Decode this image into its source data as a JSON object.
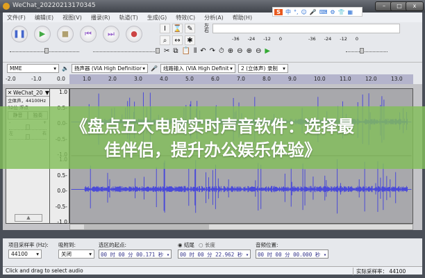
{
  "window": {
    "title": "WeChat_20220213170345"
  },
  "ime": {
    "logo": "S",
    "items": [
      "中",
      "°,",
      "☺",
      "🎤",
      "⌨",
      "⚙",
      "👕",
      "▦"
    ]
  },
  "menu": [
    "文件(F)",
    "编辑(E)",
    "视图(V)",
    "播录(R)",
    "轨道(T)",
    "生成(G)",
    "特效(C)",
    "分析(A)",
    "帮助(H)"
  ],
  "transport": [
    {
      "name": "pause",
      "glyph": "❚❚",
      "color": "#4466cc"
    },
    {
      "name": "play",
      "glyph": "▶",
      "color": "#44aa44"
    },
    {
      "name": "stop",
      "glyph": "■",
      "color": "#b0a070"
    },
    {
      "name": "skip-start",
      "glyph": "⏮",
      "color": "#9966cc"
    },
    {
      "name": "skip-end",
      "glyph": "⏭",
      "color": "#9966cc"
    },
    {
      "name": "record",
      "glyph": "●",
      "color": "#cc4444"
    }
  ],
  "tools": [
    "I",
    "⌛",
    "✎",
    "⌕",
    "↔",
    "✱"
  ],
  "meter": {
    "lr": [
      "左",
      "右"
    ],
    "scale": [
      "-36",
      "-24",
      "-12",
      "0"
    ]
  },
  "edit_tools": [
    "✂",
    "⧉",
    "📋",
    "⫴",
    "↶",
    "↷",
    "⏱",
    "⊕",
    "⊖",
    "⊕",
    "⊖",
    "▶"
  ],
  "devices": {
    "host": "MME",
    "output": "扬声器 (VIA High Definitior",
    "input": "线路输入 (VIA High Definit",
    "channels": "2 (立体声) 录制"
  },
  "ruler": [
    "-2.0",
    "-1.0",
    "0.0",
    "1.0",
    "2.0",
    "3.0",
    "4.0",
    "5.0",
    "6.0",
    "7.0",
    "8.0",
    "9.0",
    "10.0",
    "11.0",
    "12.0",
    "13.0"
  ],
  "track": {
    "name": "WeChat_20",
    "info1": "立体声，44100Hz",
    "info2": "32位 浮点",
    "mute": "静音",
    "solo": "独奏",
    "gain_min": "-",
    "gain_max": "+",
    "pan_left": "左",
    "pan_right": "右",
    "collapse": "▲",
    "vscale": [
      "1.0",
      "0.5-",
      "0.0-",
      "-0.5-",
      "-1.0"
    ]
  },
  "banner": {
    "line1": "《盘点五大电脑实时声音软件：选择最",
    "line2": "佳伴侣，提升办公娱乐体验》"
  },
  "selection": {
    "rate_label": "项目采样率 (Hz):",
    "rate": "44100",
    "snap_label": "吸附到:",
    "snap": "关闭",
    "start_label": "选区的起点:",
    "start": "00 时 00 分 00.171 秒",
    "end_radio": "结尾",
    "length_radio": "长度",
    "end": "00 时 00 分 22.962 秒",
    "pos_label": "音频位置:",
    "pos": "00 时 00 分 00.000 秒"
  },
  "status": {
    "message": "Click and drag to select audio",
    "rate": "实际采样率： 44100"
  },
  "colors": {
    "wave": "#4a4ad8",
    "banner": "#82be5a"
  }
}
